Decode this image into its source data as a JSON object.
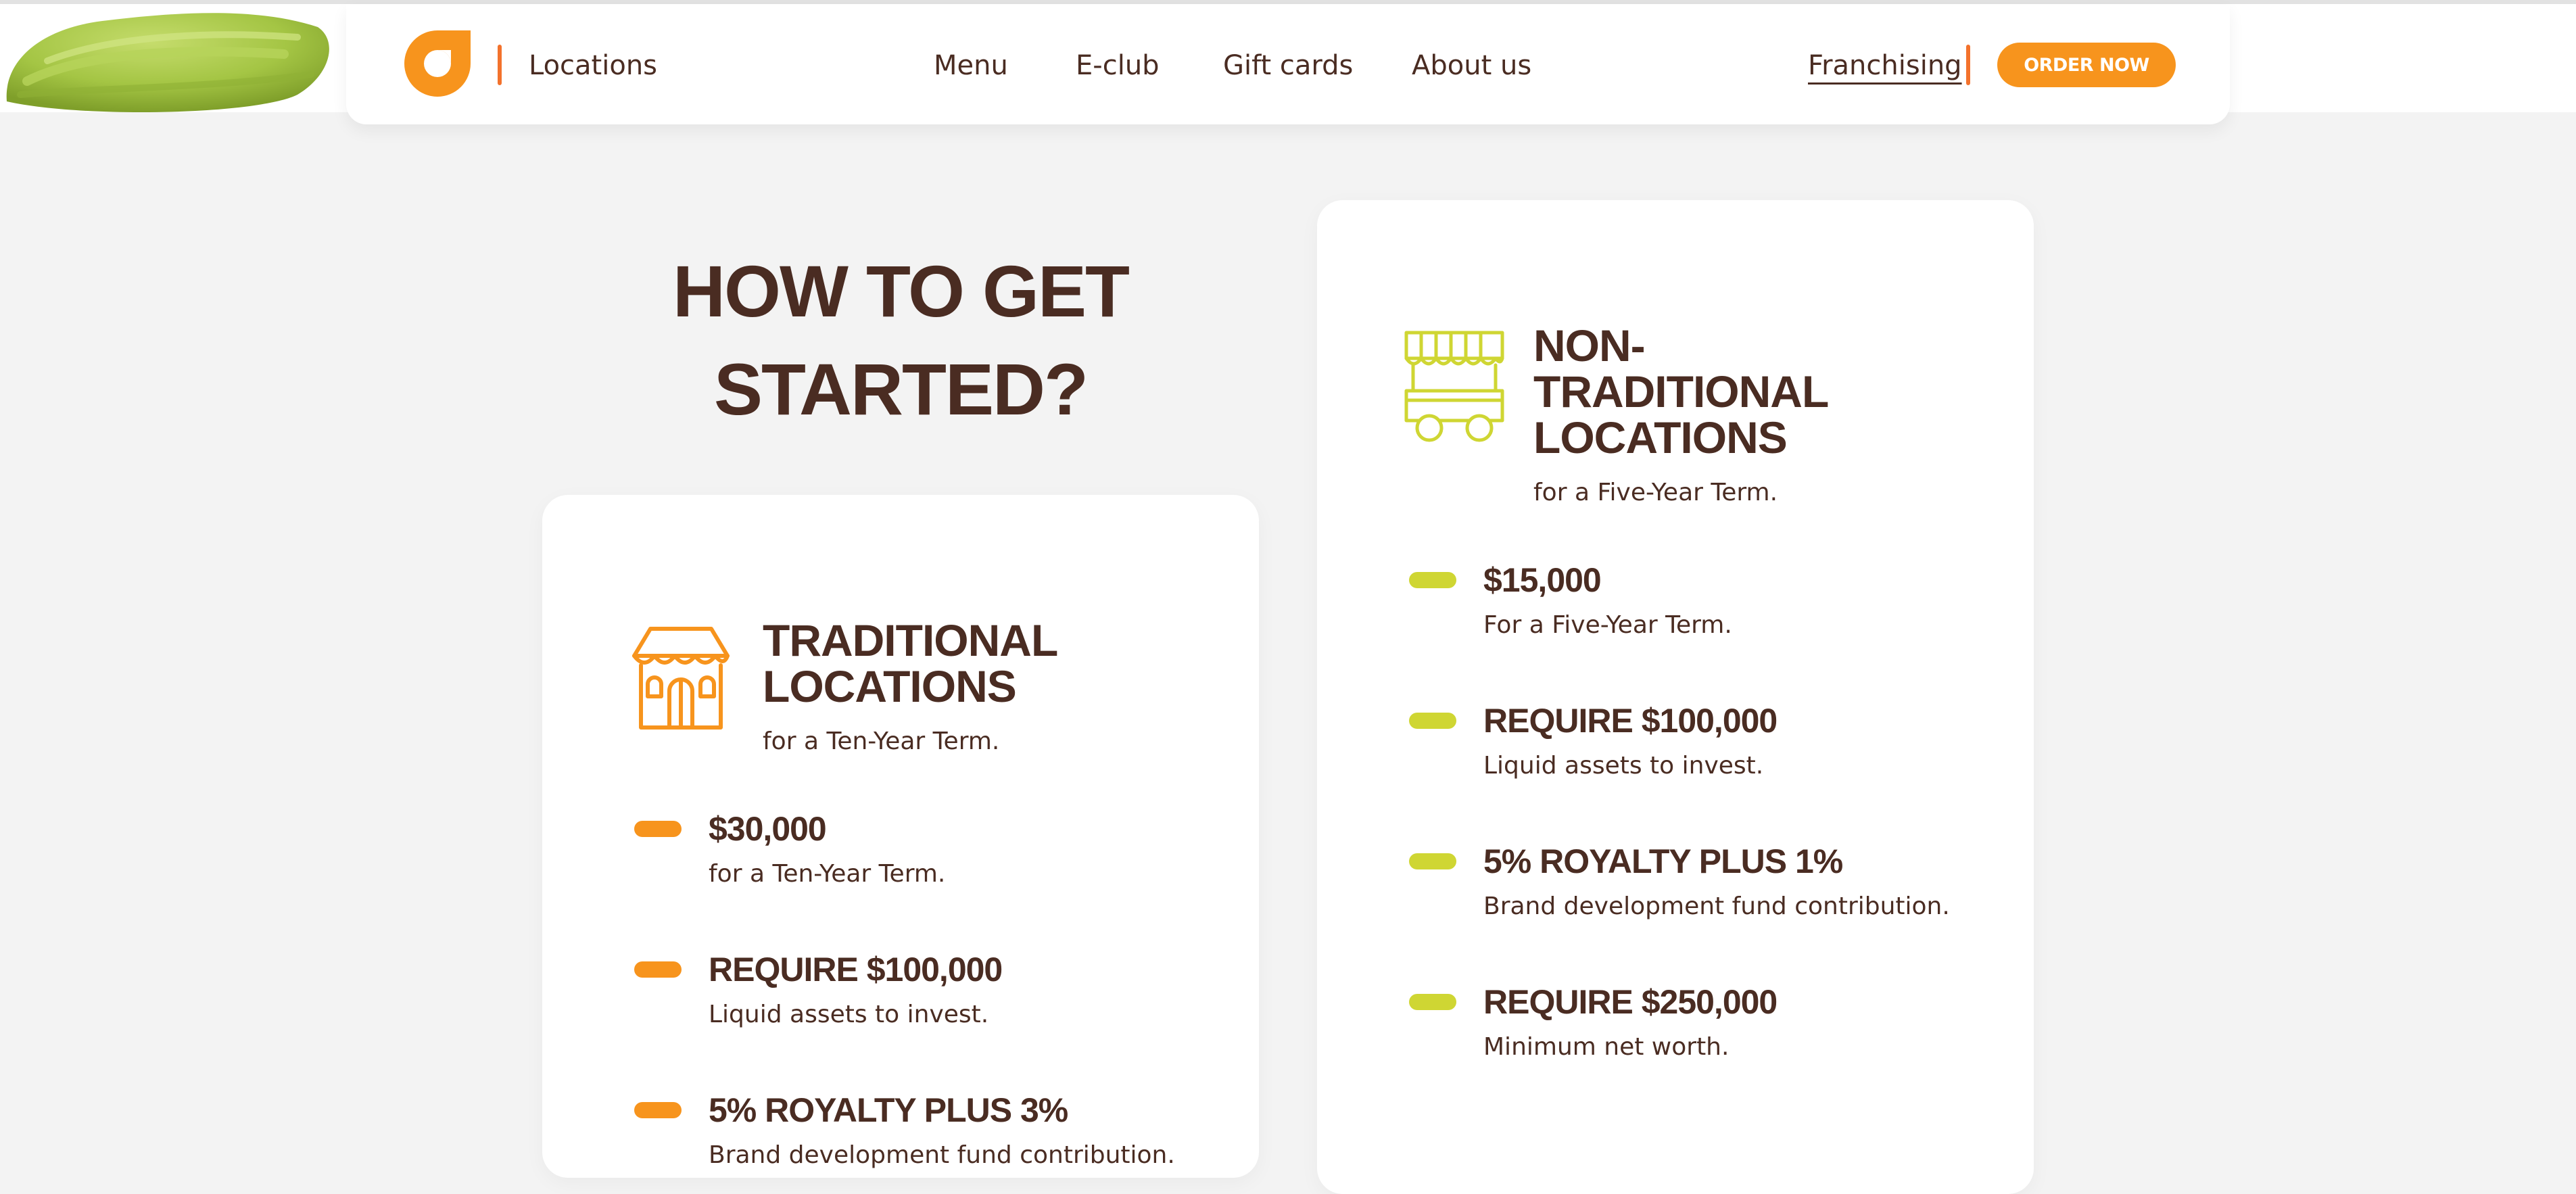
{
  "header": {
    "locations_label": "Locations",
    "nav": [
      {
        "label": "Menu"
      },
      {
        "label": "E-club"
      },
      {
        "label": "Gift cards"
      },
      {
        "label": "About us"
      }
    ],
    "franchising_label": "Franchising",
    "order_button": "ORDER NOW"
  },
  "colors": {
    "brand_orange": "#f7941d",
    "accent_red": "#f3722c",
    "lime": "#cfd633",
    "text_brown": "#4a2c22",
    "background": "#f3f3f3"
  },
  "section": {
    "heading_line1": "HOW TO GET",
    "heading_line2": "STARTED?"
  },
  "traditional": {
    "icon": "storefront-icon",
    "title_line1": "TRADITIONAL",
    "title_line2": "LOCATIONS",
    "subtitle": "for a Ten-Year Term.",
    "items": [
      {
        "title": "$30,000",
        "desc": "for a Ten-Year Term."
      },
      {
        "title": "REQUIRE $100,000",
        "desc": "Liquid assets to invest."
      },
      {
        "title": "5% ROYALTY PLUS 3%",
        "desc": "Brand development fund contribution."
      }
    ]
  },
  "non_traditional": {
    "icon": "food-cart-icon",
    "title_line1": "NON-",
    "title_line2": "TRADITIONAL",
    "title_line3": "LOCATIONS",
    "subtitle": "for a Five-Year Term.",
    "items": [
      {
        "title": "$15,000",
        "desc": "For a Five-Year Term."
      },
      {
        "title": "REQUIRE $100,000",
        "desc": "Liquid assets to invest."
      },
      {
        "title": "5% ROYALTY PLUS 1%",
        "desc": "Brand development fund contribution."
      },
      {
        "title": "REQUIRE $250,000",
        "desc": "Minimum net worth."
      }
    ]
  }
}
